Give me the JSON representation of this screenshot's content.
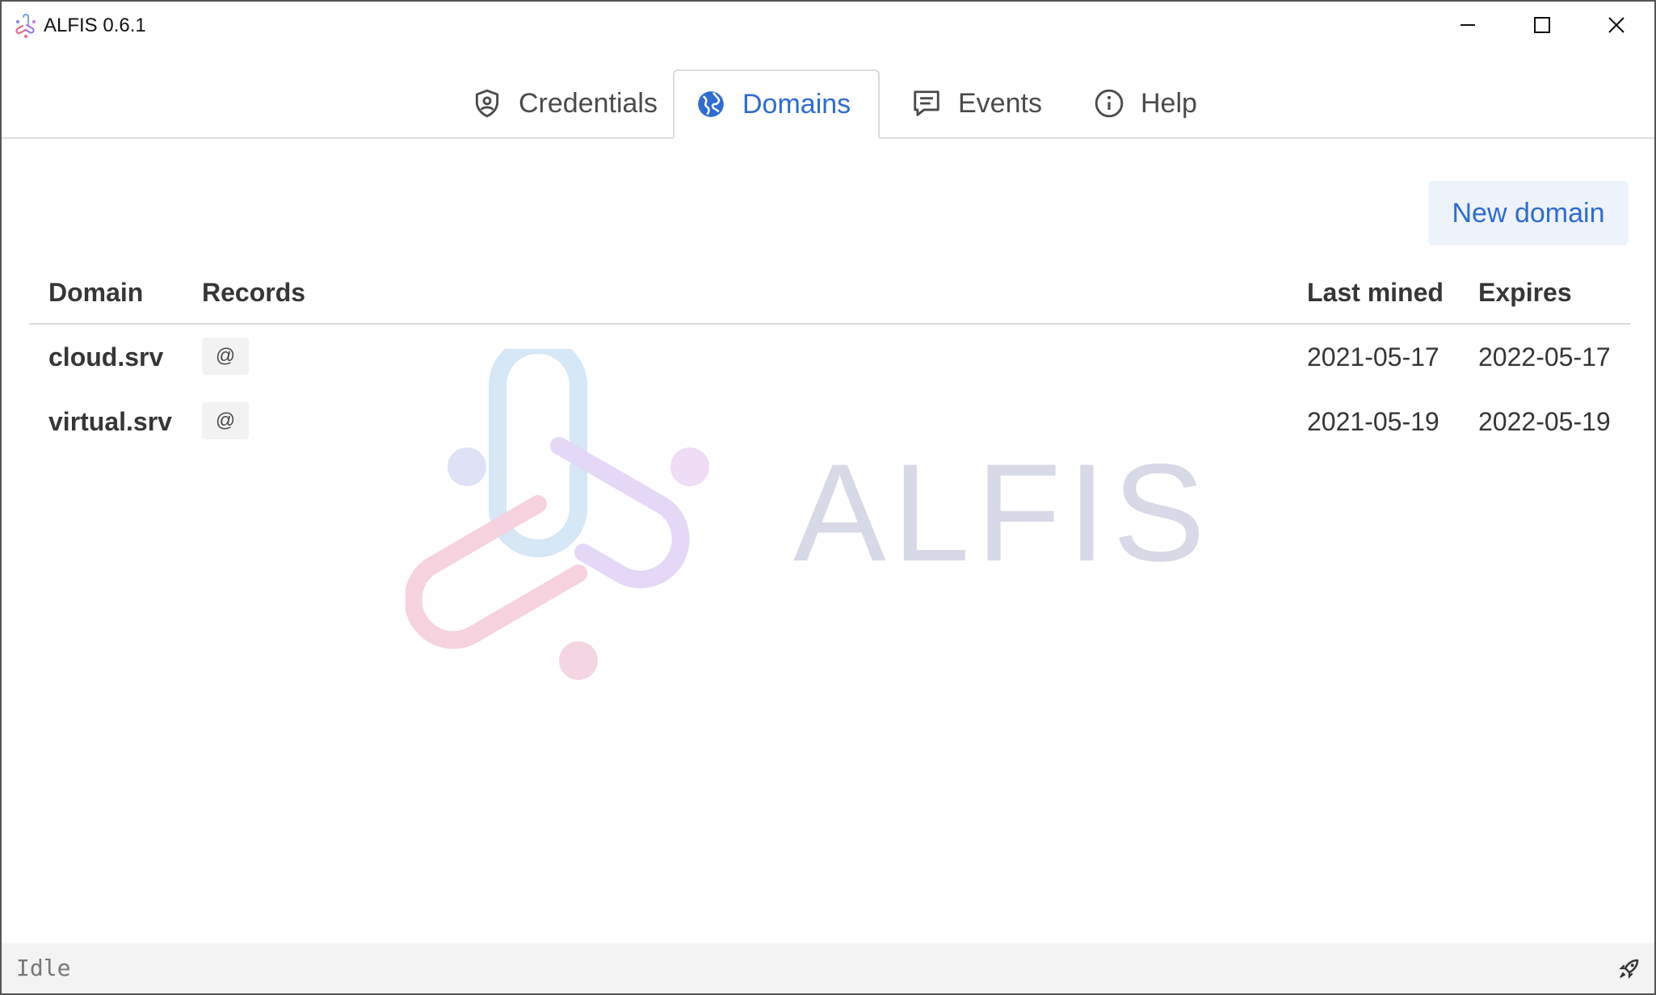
{
  "window": {
    "title": "ALFIS 0.6.1"
  },
  "icons": {
    "app": "alfis-logo-icon",
    "minimize": "minimize-icon",
    "maximize": "maximize-icon",
    "close": "close-icon",
    "credentials": "shield-user-icon",
    "domains": "globe-icon",
    "events": "message-icon",
    "help": "info-icon",
    "status": "rocket-icon"
  },
  "tabs": [
    {
      "label": "Credentials",
      "active": false
    },
    {
      "label": "Domains",
      "active": true
    },
    {
      "label": "Events",
      "active": false
    },
    {
      "label": "Help",
      "active": false
    }
  ],
  "watermark": {
    "text": "ALFIS"
  },
  "actions": {
    "new_domain": "New domain"
  },
  "table": {
    "headers": {
      "domain": "Domain",
      "records": "Records",
      "last_mined": "Last mined",
      "expires": "Expires"
    },
    "rows": [
      {
        "domain": "cloud.srv",
        "record": "@",
        "last_mined": "2021-05-17",
        "expires": "2022-05-17"
      },
      {
        "domain": "virtual.srv",
        "record": "@",
        "last_mined": "2021-05-19",
        "expires": "2022-05-19"
      }
    ]
  },
  "status": {
    "text": "Idle"
  },
  "colors": {
    "accent": "#2e6bd3",
    "button_bg": "#eef3fb",
    "watermark_text": "#d8d9e6"
  }
}
